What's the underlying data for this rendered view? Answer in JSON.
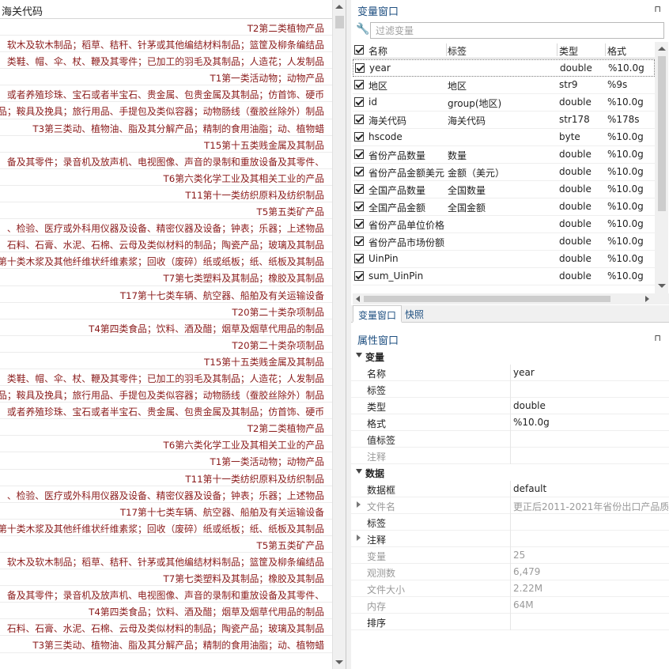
{
  "data_browser": {
    "column_header": "海关代码",
    "rows": [
      "T2第二类植物产品",
      "软木及软木制品；稻草、秸秆、针茅或其他编结材料制品；篮筐及柳条编结品",
      "类鞋、帽、伞、杖、鞭及其零件；已加工的羽毛及其制品；人造花；人发制品",
      "T1第一类活动物；动物产品",
      "或者养殖珍珠、宝石或者半宝石、贵金属、包贵金属及其制品；仿首饰、硬币",
      "品；鞍具及挽具；旅行用品、手提包及类似容器；动物肠线（蚕胶丝除外）制品",
      "T3第三类动、植物油、脂及其分解产品；精制的食用油脂；动、植物蜡",
      "T15第十五类贱金属及其制品",
      "备及其零件；录音机及放声机、电视图像、声音的录制和重放设备及其零件、",
      "T6第六类化学工业及其相关工业的产品",
      "T11第十一类纺织原料及纺织制品",
      "T5第五类矿产品",
      "、检验、医疗或外科用仪器及设备、精密仪器及设备；钟表；乐器；上述物品",
      "石料、石膏、水泥、石棉、云母及类似材料的制品；陶瓷产品；玻璃及其制品",
      "第十类木浆及其他纤维状纤维素浆；回收（废碎）纸或纸板；纸、纸板及其制品",
      "T7第七类塑料及其制品；橡胶及其制品",
      "T17第十七类车辆、航空器、船舶及有关运输设备",
      "T20第二十类杂项制品",
      "T4第四类食品；饮料、酒及醋；烟草及烟草代用品的制品",
      "T20第二十类杂项制品",
      "T15第十五类贱金属及其制品",
      "类鞋、帽、伞、杖、鞭及其零件；已加工的羽毛及其制品；人造花；人发制品",
      "品；鞍具及挽具；旅行用品、手提包及类似容器；动物肠线（蚕胶丝除外）制品",
      "或者养殖珍珠、宝石或者半宝石、贵金属、包贵金属及其制品；仿首饰、硬币",
      "T2第二类植物产品",
      "T6第六类化学工业及其相关工业的产品",
      "T1第一类活动物；动物产品",
      "T11第十一类纺织原料及纺织制品",
      "、检验、医疗或外科用仪器及设备、精密仪器及设备；钟表；乐器；上述物品",
      "T17第十七类车辆、航空器、船舶及有关运输设备",
      "第十类木浆及其他纤维状纤维素浆；回收（废碎）纸或纸板；纸、纸板及其制品",
      "T5第五类矿产品",
      "软木及软木制品；稻草、秸秆、针茅或其他编结材料制品；篮筐及柳条编结品",
      "T7第七类塑料及其制品；橡胶及其制品",
      "备及其零件；录音机及放声机、电视图像、声音的录制和重放设备及其零件、",
      "T4第四类食品；饮料、酒及醋；烟草及烟草代用品的制品",
      "石料、石膏、水泥、石棉、云母及类似材料的制品；陶瓷产品；玻璃及其制品",
      "T3第三类动、植物油、脂及其分解产品；精制的食用油脂；动、植物蜡"
    ]
  },
  "variables_window": {
    "title": "变量窗口",
    "pin": "⊓",
    "filter_placeholder": "过滤变量",
    "columns": {
      "name": "名称",
      "label": "标签",
      "type": "类型",
      "format": "格式"
    },
    "rows": [
      {
        "name": "year",
        "label": "",
        "type": "double",
        "format": "%10.0g"
      },
      {
        "name": "地区",
        "label": "地区",
        "type": "str9",
        "format": "%9s"
      },
      {
        "name": "id",
        "label": "group(地区)",
        "type": "double",
        "format": "%10.0g"
      },
      {
        "name": "海关代码",
        "label": "海关代码",
        "type": "str178",
        "format": "%178s"
      },
      {
        "name": "hscode",
        "label": "",
        "type": "byte",
        "format": "%10.0g"
      },
      {
        "name": "省份产品数量",
        "label": "数量",
        "type": "double",
        "format": "%10.0g"
      },
      {
        "name": "省份产品金额美元",
        "label": "金额（美元）",
        "type": "double",
        "format": "%10.0g"
      },
      {
        "name": "全国产品数量",
        "label": "全国数量",
        "type": "double",
        "format": "%10.0g"
      },
      {
        "name": "全国产品金额",
        "label": "全国金额",
        "type": "double",
        "format": "%10.0g"
      },
      {
        "name": "省份产品单位价格",
        "label": "",
        "type": "double",
        "format": "%10.0g"
      },
      {
        "name": "省份产品市场份额",
        "label": "",
        "type": "double",
        "format": "%10.0g"
      },
      {
        "name": "UinPin",
        "label": "",
        "type": "double",
        "format": "%10.0g"
      },
      {
        "name": "sum_UinPin",
        "label": "",
        "type": "double",
        "format": "%10.0g"
      }
    ]
  },
  "tabs": {
    "variables": "变量窗口",
    "snapshots": "快照"
  },
  "properties_window": {
    "title": "属性窗口",
    "pin": "⊓",
    "group_variable": "变量",
    "variable_props": [
      {
        "key": "名称",
        "value": "year"
      },
      {
        "key": "标签",
        "value": ""
      },
      {
        "key": "类型",
        "value": "double"
      },
      {
        "key": "格式",
        "value": "%10.0g"
      },
      {
        "key": "值标签",
        "value": ""
      },
      {
        "key": "注释",
        "value": ""
      }
    ],
    "group_data": "数据",
    "data_props": [
      {
        "key": "数据框",
        "value": "default"
      },
      {
        "key": "文件名",
        "value": "更正后2011-2021年省份出口产品质"
      },
      {
        "key": "标签",
        "value": ""
      },
      {
        "key": "注释",
        "value": ""
      },
      {
        "key": "变量",
        "value": "25"
      },
      {
        "key": "观测数",
        "value": "6,479"
      },
      {
        "key": "文件大小",
        "value": "2.22M"
      },
      {
        "key": "内存",
        "value": "64M"
      },
      {
        "key": "排序",
        "value": ""
      }
    ]
  }
}
